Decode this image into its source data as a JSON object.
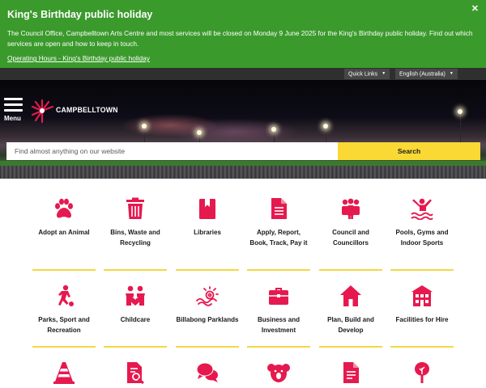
{
  "alert": {
    "title": "King's Birthday public holiday",
    "body": "The Council Office, Campbelltown Arts Centre and most services will be closed on Monday 9 June 2025 for the King's Birthday public holiday. Find out which services are open and how to keep in touch.",
    "link": "Operating Hours - King's Birthday public holiday",
    "close": "✕"
  },
  "topbar": {
    "quick_links": "Quick Links",
    "language": "English (Australia)"
  },
  "header": {
    "menu_label": "Menu",
    "logo_text": "CAMPBELLTOWN"
  },
  "search": {
    "placeholder": "Find almost anything on our website",
    "button": "Search"
  },
  "colors": {
    "accent": "#e6194f",
    "yellow": "#fbd935",
    "alert_green": "#3b9a2c"
  },
  "tiles": [
    {
      "label": "Adopt an Animal",
      "icon": "paw-icon"
    },
    {
      "label": "Bins, Waste and Recycling",
      "icon": "bin-icon"
    },
    {
      "label": "Libraries",
      "icon": "book-icon"
    },
    {
      "label": "Apply, Report, Book, Track, Pay it",
      "icon": "document-icon"
    },
    {
      "label": "Council and Councillors",
      "icon": "people-icon"
    },
    {
      "label": "Pools, Gyms and Indoor Sports",
      "icon": "swimmer-icon"
    },
    {
      "label": "Parks, Sport and Recreation",
      "icon": "soccer-player-icon"
    },
    {
      "label": "Childcare",
      "icon": "childcare-icon"
    },
    {
      "label": "Billabong Parklands",
      "icon": "billabong-icon"
    },
    {
      "label": "Business and Investment",
      "icon": "briefcase-icon"
    },
    {
      "label": "Plan, Build and Develop",
      "icon": "house-icon"
    },
    {
      "label": "Facilities for Hire",
      "icon": "building-icon"
    },
    {
      "label": "",
      "icon": "traffic-cone-icon"
    },
    {
      "label": "",
      "icon": "document-search-icon"
    },
    {
      "label": "",
      "icon": "chat-icon"
    },
    {
      "label": "",
      "icon": "koala-icon"
    },
    {
      "label": "",
      "icon": "document-lines-icon"
    },
    {
      "label": "",
      "icon": "tree-icon"
    }
  ]
}
